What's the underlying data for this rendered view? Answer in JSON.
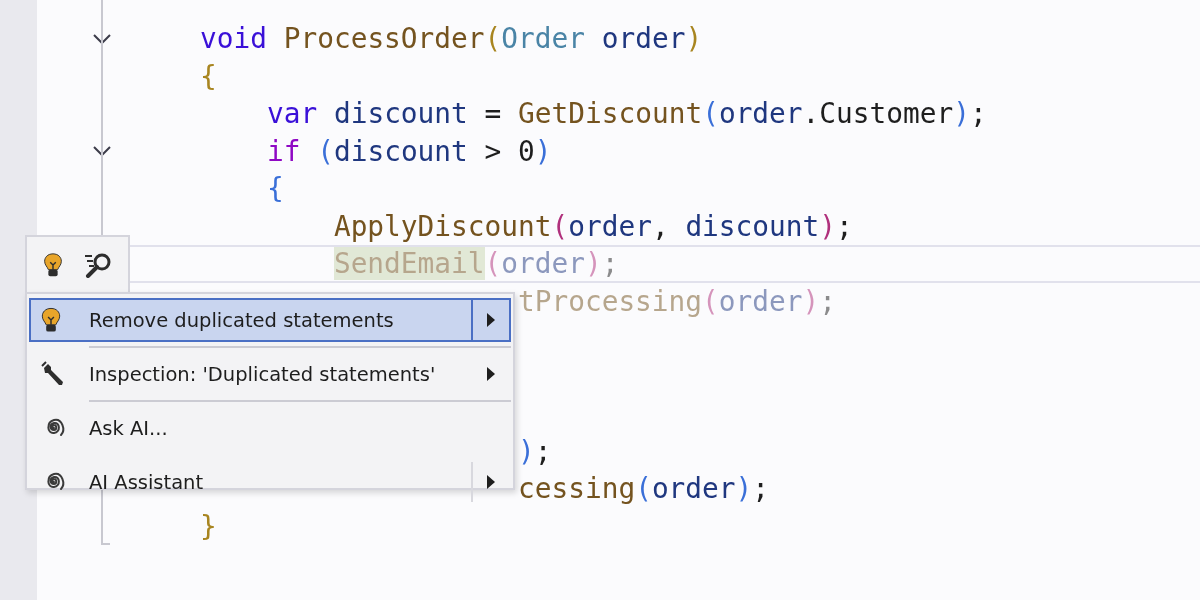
{
  "code_lines": [
    {
      "foldable": true,
      "current": false,
      "dimmed": false,
      "tokens": [
        {
          "text": "void",
          "kind": "keyword"
        },
        {
          "text": " ProcessOrder",
          "kind": "method"
        },
        {
          "text": "(",
          "kind": "paren1"
        },
        {
          "text": "Order",
          "kind": "type"
        },
        {
          "text": " order",
          "kind": "variable"
        },
        {
          "text": ")",
          "kind": "paren1"
        }
      ]
    },
    {
      "foldable": false,
      "current": false,
      "dimmed": false,
      "tokens": [
        {
          "text": "{",
          "kind": "paren1"
        }
      ]
    },
    {
      "foldable": false,
      "current": false,
      "dimmed": false,
      "tokens": [
        {
          "text": "    var",
          "kind": "keyword"
        },
        {
          "text": " discount",
          "kind": "variable"
        },
        {
          "text": " = ",
          "kind": "plain"
        },
        {
          "text": "GetDiscount",
          "kind": "method"
        },
        {
          "text": "(",
          "kind": "paren2"
        },
        {
          "text": "order",
          "kind": "variable"
        },
        {
          "text": ".Customer",
          "kind": "plain"
        },
        {
          "text": ")",
          "kind": "paren2"
        },
        {
          "text": ";",
          "kind": "plain"
        }
      ]
    },
    {
      "foldable": true,
      "current": false,
      "dimmed": false,
      "tokens": [
        {
          "text": "    if",
          "kind": "control"
        },
        {
          "text": " (",
          "kind": "paren2"
        },
        {
          "text": "discount",
          "kind": "variable"
        },
        {
          "text": " > 0",
          "kind": "plain"
        },
        {
          "text": ")",
          "kind": "paren2"
        }
      ]
    },
    {
      "foldable": false,
      "current": false,
      "dimmed": false,
      "tokens": [
        {
          "text": "    {",
          "kind": "paren2"
        }
      ]
    },
    {
      "foldable": false,
      "current": false,
      "dimmed": false,
      "tokens": [
        {
          "text": "        ApplyDiscount",
          "kind": "method"
        },
        {
          "text": "(",
          "kind": "paren3"
        },
        {
          "text": "order",
          "kind": "variable"
        },
        {
          "text": ", ",
          "kind": "plain"
        },
        {
          "text": "discount",
          "kind": "variable"
        },
        {
          "text": ")",
          "kind": "paren3"
        },
        {
          "text": ";",
          "kind": "plain"
        }
      ]
    }
  ],
  "covered_lines": [
    {
      "current": true,
      "dimmed": true,
      "tokens": [
        {
          "text": "        SendEmail",
          "kind": "highlighted"
        },
        {
          "text": "(",
          "kind": "paren3"
        },
        {
          "text": "order",
          "kind": "variable"
        },
        {
          "text": ")",
          "kind": "paren3"
        },
        {
          "text": ";",
          "kind": "plain"
        }
      ]
    },
    {
      "current": false,
      "dimmed": true,
      "tokens": [
        {
          "text": "                   tProcessing",
          "kind": "method"
        },
        {
          "text": "(",
          "kind": "paren3"
        },
        {
          "text": "order",
          "kind": "variable"
        },
        {
          "text": ")",
          "kind": "paren3"
        },
        {
          "text": ";",
          "kind": "plain"
        }
      ]
    },
    {
      "current": false,
      "dimmed": false,
      "tokens": [
        {
          "text": "                   )",
          "kind": "paren2"
        },
        {
          "text": ";",
          "kind": "plain"
        }
      ]
    },
    {
      "current": false,
      "dimmed": false,
      "tokens": [
        {
          "text": "                   cessing",
          "kind": "method"
        },
        {
          "text": "(",
          "kind": "paren2"
        },
        {
          "text": "order",
          "kind": "variable"
        },
        {
          "text": ")",
          "kind": "paren2"
        },
        {
          "text": ";",
          "kind": "plain"
        }
      ]
    }
  ],
  "closing_line": {
    "tokens": [
      {
        "text": "}",
        "kind": "paren1"
      }
    ]
  },
  "menu": [
    {
      "kind": "quickfix",
      "label": "Remove duplicated statements",
      "submenu": true,
      "split": true,
      "selected": true,
      "separator_after": true
    },
    {
      "kind": "inspection",
      "label": "Inspection: 'Duplicated statements'",
      "submenu": true,
      "split": false,
      "selected": false,
      "separator_after": true
    },
    {
      "kind": "ai",
      "label": "Ask AI...",
      "submenu": false,
      "split": false,
      "selected": false,
      "separator_after": false
    },
    {
      "kind": "ai",
      "label": "AI Assistant",
      "submenu": true,
      "split": true,
      "selected": false,
      "separator_after": false
    }
  ]
}
